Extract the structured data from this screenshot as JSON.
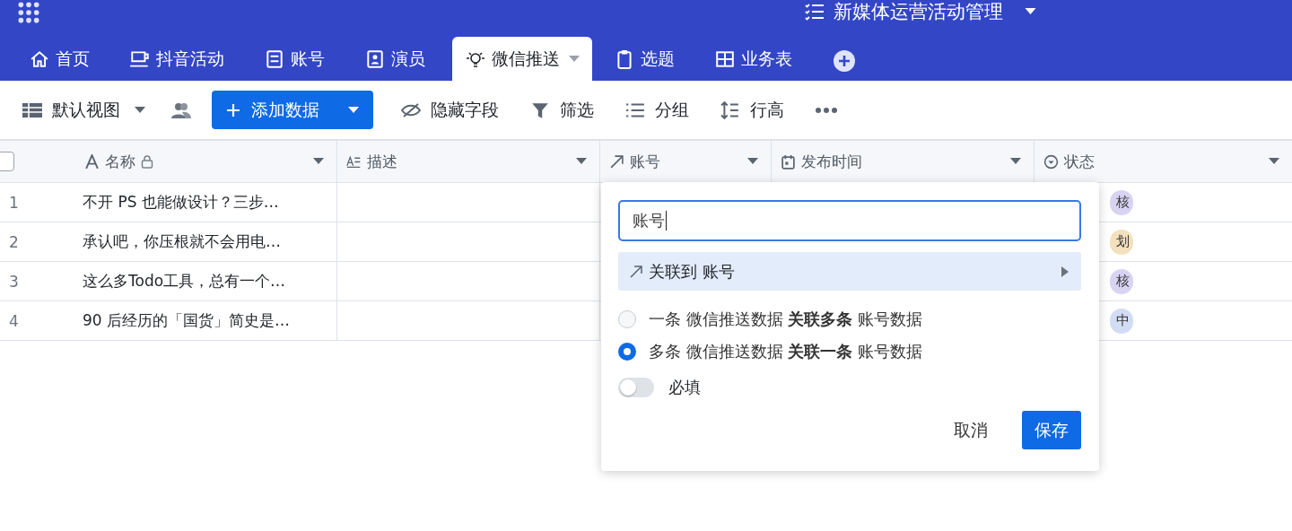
{
  "app_title": "新媒体运营活动管理",
  "tabs": [
    {
      "label": "首页",
      "kind": "home",
      "selected": false
    },
    {
      "label": "抖音活动",
      "kind": "cup",
      "selected": false
    },
    {
      "label": "账号",
      "kind": "card",
      "selected": false
    },
    {
      "label": "演员",
      "kind": "contact",
      "selected": false
    },
    {
      "label": "微信推送",
      "kind": "bulb",
      "selected": true
    },
    {
      "label": "选题",
      "kind": "clipboard",
      "selected": false
    },
    {
      "label": "业务表",
      "kind": "grid",
      "selected": false
    }
  ],
  "toolbar": {
    "view": "默认视图",
    "add": "添加数据",
    "items": [
      {
        "label": "隐藏字段",
        "kind": "eye"
      },
      {
        "label": "筛选",
        "kind": "filter"
      },
      {
        "label": "分组",
        "kind": "list"
      },
      {
        "label": "行高",
        "kind": "height"
      }
    ]
  },
  "table": {
    "all_checked": false,
    "columns": [
      {
        "label": "名称",
        "kind": "text",
        "locked": true
      },
      {
        "label": "描述",
        "kind": "desc",
        "locked": false
      },
      {
        "label": "账号",
        "kind": "link",
        "locked": false
      },
      {
        "label": "发布时间",
        "kind": "calendar",
        "locked": false
      },
      {
        "label": "状态",
        "kind": "select",
        "locked": false
      }
    ],
    "rows": [
      {
        "number": "1",
        "name": "不开 PS 也能做设计？三步…",
        "status": "核",
        "color": "#d9d3f2"
      },
      {
        "number": "2",
        "name": "承认吧，你压根就不会用电…",
        "status": "划",
        "color": "#f3e0bd"
      },
      {
        "number": "3",
        "name": "这么多Todo工具，总有一个…",
        "status": "核",
        "color": "#d9d3f2"
      },
      {
        "number": "4",
        "name": "90 后经历的「国货」简史是…",
        "status": "中",
        "color": "#d2dcf3"
      }
    ]
  },
  "popup": {
    "field_value": "账号",
    "link_option": "关联到 账号",
    "radios": [
      {
        "label": "一条 微信推送数据 **关联多条** 账号数据",
        "selected": false
      },
      {
        "label": "多条 微信推送数据 **关联一条** 账号数据",
        "selected": true
      }
    ],
    "required": {
      "label": "必填",
      "on": false
    },
    "cancel": "取消",
    "save": "保存"
  }
}
